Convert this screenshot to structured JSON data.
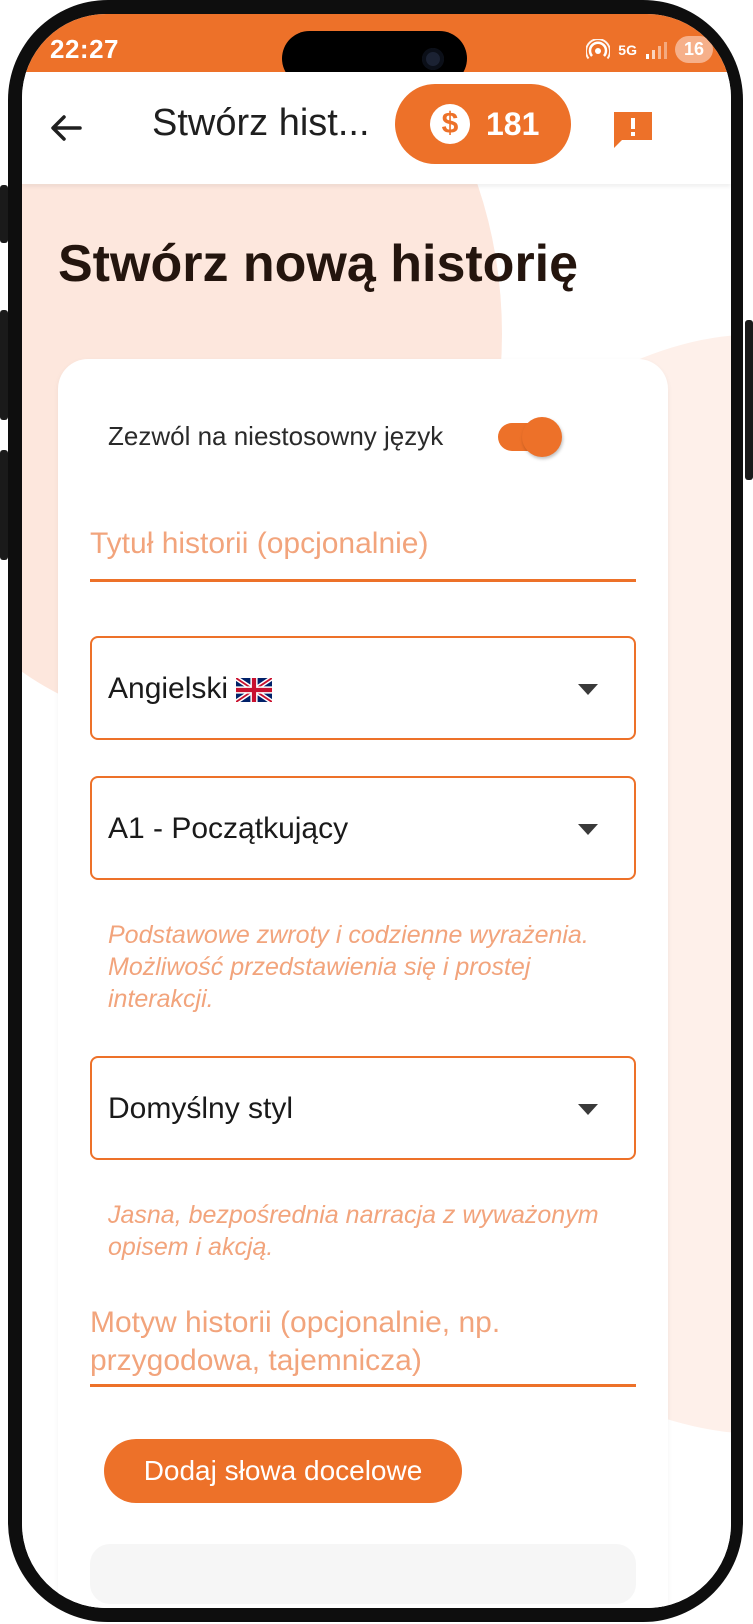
{
  "status_bar": {
    "time": "22:27",
    "network": "5G",
    "battery": "16"
  },
  "app_bar": {
    "title": "Stwórz hist...",
    "coins": "181",
    "coin_symbol": "$"
  },
  "page": {
    "title": "Stwórz nową historię"
  },
  "form": {
    "toggle": {
      "label": "Zezwól na niestosowny język",
      "on": true
    },
    "title_field": {
      "placeholder": "Tytuł historii (opcjonalnie)"
    },
    "language_select": {
      "value": "Angielski",
      "flag_icon": "uk-flag-icon"
    },
    "level_select": {
      "value": "A1 - Początkujący"
    },
    "level_description": "Podstawowe zwroty i codzienne wyrażenia. Możliwość przedstawienia się i prostej interakcji.",
    "style_select": {
      "value": "Domyślny styl"
    },
    "style_description": "Jasna, bezpośrednia narracja z wyważonym opisem i akcją.",
    "theme_field": {
      "placeholder": "Motyw historii (opcjonalnie, np. przygodowa, tajemnicza)"
    },
    "add_words_button": "Dodaj słowa docelowe"
  },
  "colors": {
    "accent": "#ed7129",
    "placeholder": "#f2a47c",
    "blob": "#fde7dd"
  }
}
